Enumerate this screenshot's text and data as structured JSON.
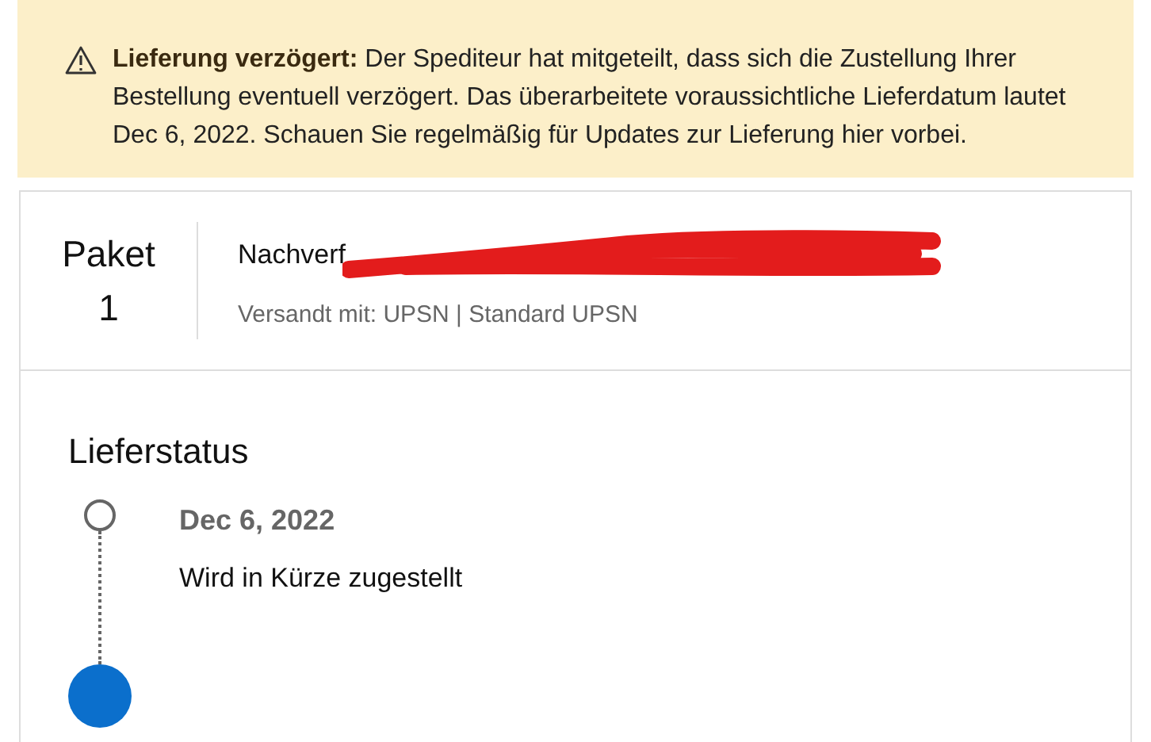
{
  "alert": {
    "title": "Lieferung verzögert:",
    "message": "Der Spediteur hat mitgeteilt, dass sich die Zustellung Ihrer Bestellung eventuell verzögert. Das überarbeitete voraussichtliche Lieferdatum lautet Dec 6, 2022. Schauen Sie regelmäßig für Updates zur Lieferung hier vorbei."
  },
  "package": {
    "label": "Paket",
    "number": "1",
    "tracking_label": "Nachverf",
    "shipped_with": "Versandt mit: UPSN | Standard UPSN"
  },
  "delivery_status": {
    "title": "Lieferstatus",
    "events": [
      {
        "done": false,
        "date": "Dec 6, 2022",
        "text": "Wird in Kürze zugestellt"
      },
      {
        "done": true
      }
    ]
  }
}
